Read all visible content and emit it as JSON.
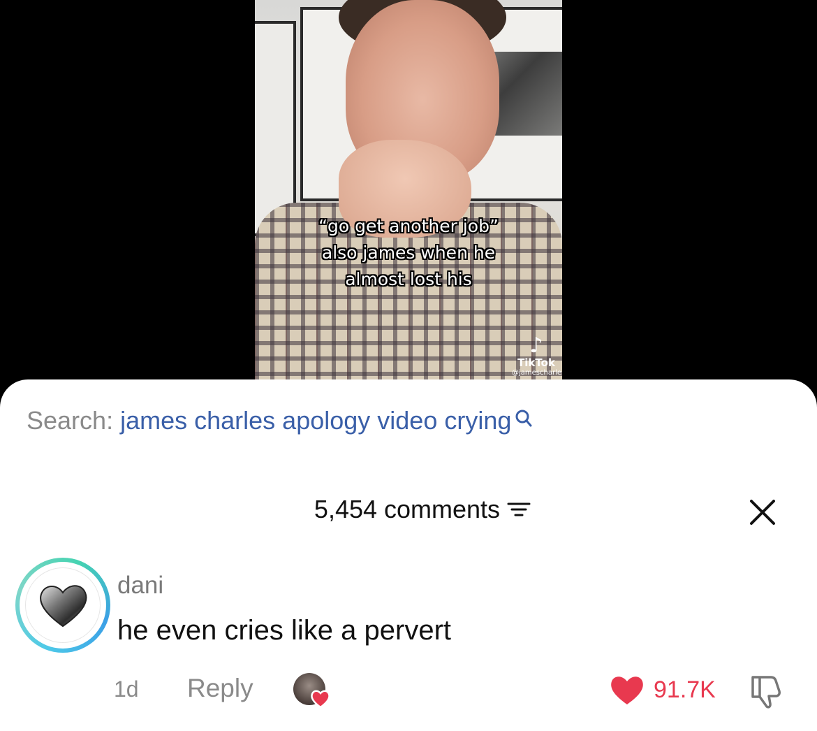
{
  "video": {
    "caption_lines": [
      "“go get another job”",
      "also james when he",
      "almost lost his"
    ],
    "watermark": {
      "brand": "TikTok",
      "handle": "@jamescharles"
    }
  },
  "search": {
    "label": "Search:",
    "query": "james charles apology video crying",
    "icon": "search-icon"
  },
  "comments": {
    "count_label": "5,454 comments",
    "filter_icon": "filter-icon",
    "close_icon": "close-icon",
    "items": [
      {
        "username": "dani",
        "text": "he even cries like a pervert",
        "time": "1d",
        "reply_label": "Reply",
        "like_count": "91.7K",
        "liked": true,
        "creator_liked": true
      }
    ]
  },
  "colors": {
    "accent_link": "#3a5fa8",
    "like_red": "#e8394f",
    "muted_text": "#8a8a8a",
    "avatar_ring": "#4ec9e8"
  }
}
